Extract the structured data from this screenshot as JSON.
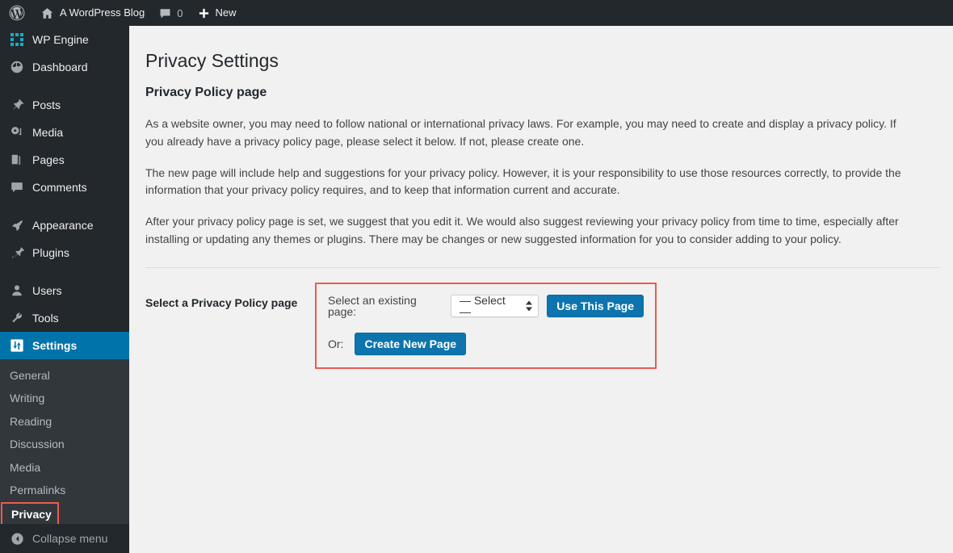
{
  "adminbar": {
    "site_name": "A WordPress Blog",
    "comment_count": "0",
    "new_label": "New",
    "wp_logo_icon": "wordpress-logo-icon",
    "home_icon": "home-icon",
    "comment_icon": "comment-bubble-icon",
    "plus_icon": "plus-icon"
  },
  "sidebar": {
    "items": [
      {
        "label": "WP Engine",
        "icon": "wpengine-grid-icon"
      },
      {
        "label": "Dashboard",
        "icon": "dashboard-gauge-icon"
      },
      {
        "label": "Posts",
        "icon": "pin-icon"
      },
      {
        "label": "Media",
        "icon": "media-icon"
      },
      {
        "label": "Pages",
        "icon": "pages-icon"
      },
      {
        "label": "Comments",
        "icon": "comment-bubble-icon"
      },
      {
        "label": "Appearance",
        "icon": "paintbrush-icon"
      },
      {
        "label": "Plugins",
        "icon": "plug-icon"
      },
      {
        "label": "Users",
        "icon": "user-icon"
      },
      {
        "label": "Tools",
        "icon": "wrench-icon"
      },
      {
        "label": "Settings",
        "icon": "settings-sliders-icon"
      }
    ],
    "submenu": [
      "General",
      "Writing",
      "Reading",
      "Discussion",
      "Media",
      "Permalinks",
      "Privacy"
    ],
    "active_item": "Settings",
    "highlighted_subitem": "Privacy",
    "collapse_label": "Collapse menu",
    "collapse_icon": "collapse-arrow-icon",
    "active_color": "#0073aa",
    "highlight_color": "#ef5a4d"
  },
  "main": {
    "page_title": "Privacy Settings",
    "section_title": "Privacy Policy page",
    "paragraphs": [
      "As a website owner, you may need to follow national or international privacy laws. For example, you may need to create and display a privacy policy. If you already have a privacy policy page, please select it below. If not, please create one.",
      "The new page will include help and suggestions for your privacy policy. However, it is your responsibility to use those resources correctly, to provide the information that your privacy policy requires, and to keep that information current and accurate.",
      "After your privacy policy page is set, we suggest that you edit it. We would also suggest reviewing your privacy policy from time to time, especially after installing or updating any themes or plugins. There may be changes or new suggested information for you to consider adding to your policy."
    ],
    "form": {
      "row_label": "Select a Privacy Policy page",
      "existing_page_label": "Select an existing page:",
      "select_value": "— Select —",
      "use_this_page_label": "Use This Page",
      "or_label": "Or:",
      "create_new_page_label": "Create New Page",
      "button_color": "#0d74ad",
      "box_border_color": "#ef5a4d"
    }
  }
}
